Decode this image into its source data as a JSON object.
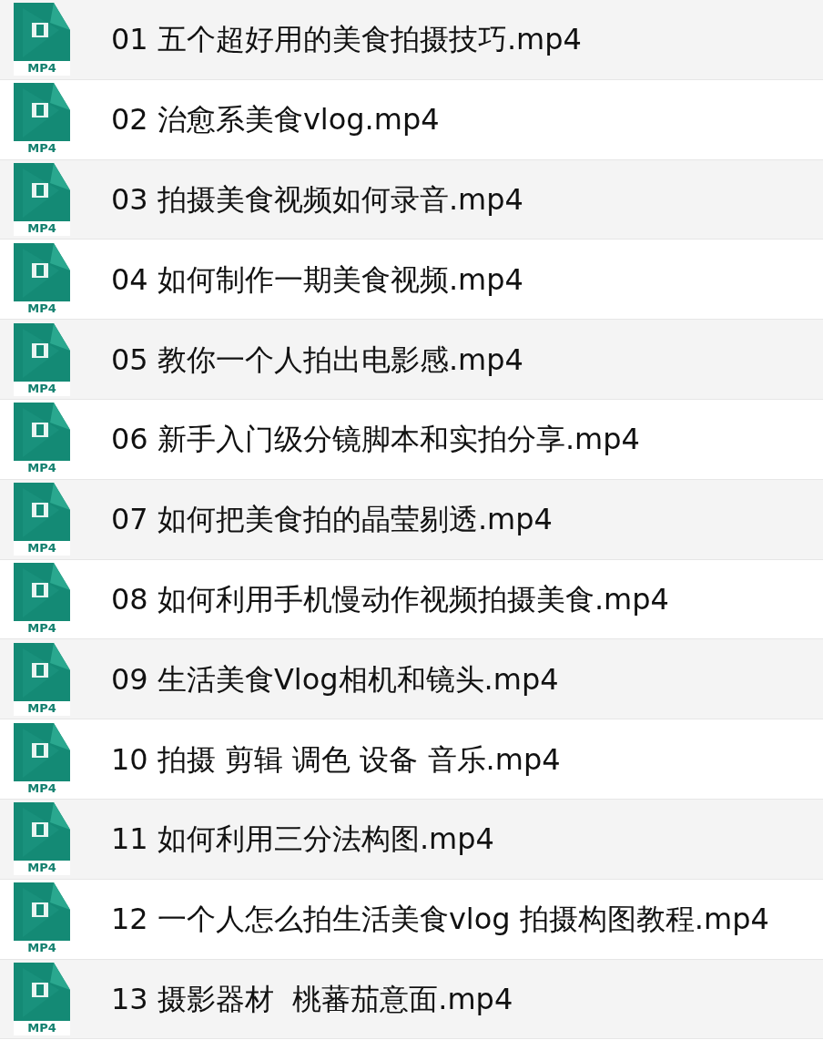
{
  "files": [
    {
      "name": "01 五个超好用的美食拍摄技巧.mp4",
      "icon_label": "MP4"
    },
    {
      "name": "02 治愈系美食vlog.mp4",
      "icon_label": "MP4"
    },
    {
      "name": "03 拍摄美食视频如何录音.mp4",
      "icon_label": "MP4"
    },
    {
      "name": "04 如何制作一期美食视频.mp4",
      "icon_label": "MP4"
    },
    {
      "name": "05 教你一个人拍出电影感.mp4",
      "icon_label": "MP4"
    },
    {
      "name": "06 新手入门级分镜脚本和实拍分享.mp4",
      "icon_label": "MP4"
    },
    {
      "name": "07 如何把美食拍的晶莹剔透.mp4",
      "icon_label": "MP4"
    },
    {
      "name": "08 如何利用手机慢动作视频拍摄美食.mp4",
      "icon_label": "MP4"
    },
    {
      "name": "09 生活美食Vlog相机和镜头.mp4",
      "icon_label": "MP4"
    },
    {
      "name": "10 拍摄 剪辑 调色 设备 音乐.mp4",
      "icon_label": "MP4"
    },
    {
      "name": "11 如何利用三分法构图.mp4",
      "icon_label": "MP4"
    },
    {
      "name": "12 一个人怎么拍生活美食vlog 拍摄构图教程.mp4",
      "icon_label": "MP4"
    },
    {
      "name": "13 摄影器材  桃蕃茄意面.mp4",
      "icon_label": "MP4"
    }
  ]
}
